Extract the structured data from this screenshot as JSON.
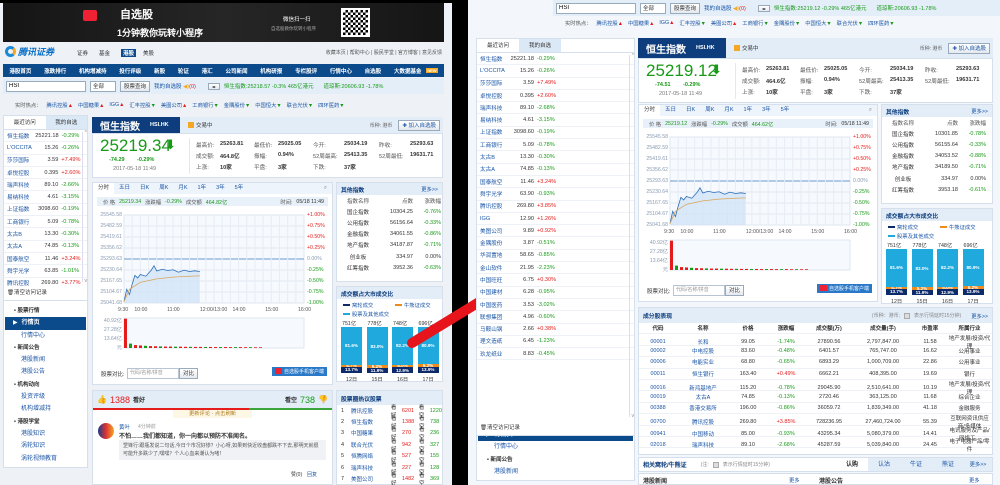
{
  "colors": {
    "up": "#e41c1c",
    "down": "#189a18",
    "brand": "#0b4a8b",
    "arrow": "#e8141b",
    "cyan": "#1fa9dc",
    "orange": "#f08a1c",
    "navy": "#0d2a6b"
  },
  "common": {
    "top_tabs": [
      "证券",
      "基金",
      "港股",
      "美股"
    ],
    "top_links": "收藏本页 | 帮助中心 | 股民学堂 | 官方博客 | 意见反馈",
    "nav": [
      "港股首页",
      "涨跌排行",
      "机构增减持",
      "投行评级",
      "新股",
      "轮证",
      "港汇",
      "公司新闻",
      "机构研报",
      "专栏股评",
      "行情中心",
      "自选股",
      "大数据基金"
    ],
    "nav_badge": "NEW",
    "banner": {
      "title": "自选股",
      "subtitle": "1分钟教你玩转小程序",
      "wechat": "微信扫一扫",
      "wechat_sub": "自选股教你玩转小程序"
    },
    "logo": "腾讯证券",
    "search": {
      "value": "HSI",
      "select": "全部",
      "button": "股票查询",
      "mywatch": "我的自选股",
      "mywatch_count": "(0)"
    },
    "hot": {
      "label": "实时热点：",
      "items": [
        [
          "腾讯控股",
          "up"
        ],
        [
          "中国糖果",
          "up"
        ],
        [
          "IGG",
          "up"
        ],
        [
          "汇丰控股",
          "down"
        ],
        [
          "美图公司",
          "up"
        ],
        [
          "工商银行",
          "down"
        ],
        [
          "金隅股份",
          "down"
        ],
        [
          "中国恒大",
          "down"
        ],
        [
          "联合光伏",
          "down"
        ],
        [
          "四环医药",
          "down"
        ]
      ]
    },
    "sidebar_tabs": [
      "最近访问",
      "我的自选"
    ],
    "clear_record": "清空访问记录",
    "header": {
      "title": "恒生指数",
      "code": "HSI.HK",
      "status": "交易中",
      "currency": "币种: 港币",
      "add": "加入自选股"
    },
    "stat_labels": [
      "最高价:",
      "最低价:",
      "今开:",
      "昨收:",
      "成交额:",
      "振幅:",
      "52周最高:",
      "52周最低:",
      "上涨:",
      "平盘:",
      "下跌:"
    ],
    "chart_tabs": [
      "分时",
      "五日",
      "日K",
      "周K",
      "月K",
      "1年",
      "3年",
      "5年"
    ],
    "info_labels": [
      "价 格",
      "涨跌幅",
      "成交额",
      "时间:"
    ],
    "y_labels": [
      "25545.58",
      "25482.59",
      "25419.61",
      "25356.62",
      "25293.63",
      "25230.64",
      "25167.65",
      "25104.67",
      "25041.68"
    ],
    "pct_labels": [
      "+1.00%",
      "+0.75%",
      "+0.50%",
      "+0.25%",
      "0.00%",
      "-0.25%",
      "-0.50%",
      "-0.75%",
      "-1.00%"
    ],
    "time_labels": [
      [
        "9:30",
        0
      ],
      [
        "10:00",
        30
      ],
      [
        "11:00",
        90
      ],
      [
        "12:00/13:00",
        150
      ],
      [
        "14:00",
        210
      ],
      [
        "15:00",
        270
      ],
      [
        "16:00",
        330
      ]
    ],
    "vol_labels": [
      "40.92亿",
      "27.28亿",
      "13.64亿",
      "元"
    ],
    "price_range": [
      25041.68,
      25545.58
    ],
    "intraday": [
      [
        0,
        25050
      ],
      [
        5,
        25120
      ],
      [
        10,
        25090
      ],
      [
        15,
        25150
      ],
      [
        20,
        25200
      ],
      [
        25,
        25185
      ],
      [
        30,
        25205
      ],
      [
        40,
        25195
      ],
      [
        50,
        25230
      ],
      [
        55,
        25255
      ],
      [
        60,
        25225
      ],
      [
        70,
        25235
      ],
      [
        80,
        25228
      ],
      [
        90,
        25232
      ],
      [
        100,
        25218
      ],
      [
        110,
        25230
      ],
      [
        120,
        25222
      ],
      [
        130,
        25226
      ],
      [
        139,
        25222
      ]
    ],
    "average": [
      [
        0,
        25050
      ],
      [
        10,
        25120
      ],
      [
        30,
        25160
      ],
      [
        60,
        25180
      ],
      [
        90,
        25190
      ],
      [
        120,
        25195
      ],
      [
        139,
        25197
      ]
    ],
    "volume": [
      40,
      6,
      4,
      3.5,
      3,
      2.6,
      2.4,
      2.2,
      2,
      2,
      1.8,
      1.8,
      1.6,
      1.6,
      1.5,
      1.5,
      1.4,
      1.4,
      1.3,
      1.3,
      1.3,
      1.2,
      1.2,
      1.2,
      1.1,
      1.1,
      1,
      1
    ],
    "compare": {
      "label": "股票对比:",
      "placeholder": "代码/名称/拼音",
      "button": "对比",
      "client": "自选股手机客户端"
    },
    "other_title": "其他指数",
    "more": "更多>>",
    "other_headers": [
      "指数名称",
      "点数",
      "涨跌幅"
    ],
    "ratio": {
      "title": "成交额占大市成交比",
      "legend": [
        "窝轮成交",
        "牛熊证成交",
        "股票及其他成交"
      ],
      "bars": [
        {
          "total": "751亿",
          "stock": 81.6,
          "cbbc": 4.7,
          "warrant": 13.7,
          "day": "12日"
        },
        {
          "total": "778亿",
          "stock": 83.0,
          "cbbc": 5.2,
          "warrant": 11.9,
          "day": "15日"
        },
        {
          "total": "748亿",
          "stock": 82.2,
          "cbbc": 5.0,
          "warrant": 12.9,
          "day": "16日"
        },
        {
          "total": "696亿",
          "stock": 80.9,
          "cbbc": 5.2,
          "warrant": 13.9,
          "day": "17日"
        }
      ]
    },
    "sidenav": [
      {
        "title": "股票行情",
        "items": [
          "行情页",
          "行情中心"
        ]
      },
      {
        "title": "新闻公告",
        "items": [
          "港股新闻",
          "港股公告"
        ]
      },
      {
        "title": "机构动向",
        "items": [
          "投资评级",
          "机构增减持"
        ]
      },
      {
        "title": "港股学堂",
        "items": [
          "港股知识",
          "涡轮知识",
          "涡轮视频教育"
        ]
      }
    ],
    "sidenav_active": "行情页"
  },
  "left": {
    "ticker": "恒生指数:25218.57 -0.3% 465亿港元",
    "ticker2": "道琼斯:20606.93 -1.78%",
    "watchlist": [
      [
        "恒生指数",
        "25221.18",
        "-0.29%"
      ],
      [
        "L'OCCITA",
        "15.26",
        "-0.26%"
      ],
      [
        "莎莎国际",
        "3.59",
        "+7.49%"
      ],
      [
        "卓悦控股",
        "0.395",
        "+2.60%"
      ],
      [
        "瑞声科技",
        "89.10",
        "-2.66%"
      ],
      [
        "易纳科技",
        "4.61",
        "-3.15%"
      ],
      [
        "上证指数",
        "3098.60",
        "-0.19%"
      ],
      [
        "工商银行",
        "5.09",
        "-0.78%"
      ],
      [
        "太古B",
        "13.30",
        "-0.30%"
      ],
      [
        "太古A",
        "74.85",
        "-0.13%"
      ],
      [
        "国泰航空",
        "11.46",
        "+3.24%"
      ],
      [
        "舜宇光学",
        "63.85",
        "-1.01%"
      ],
      [
        "腾讯控股",
        "269.80",
        "+3.77%"
      ]
    ],
    "quote": {
      "price": "25219.34",
      "change": "-74.29",
      "pct": "-0.29%",
      "time": "2017-05-18 11:49",
      "stats": [
        "25263.81",
        "25025.05",
        "25034.19",
        "25293.63",
        "464.8亿",
        "0.94%",
        "25413.35",
        "19631.71",
        "10家",
        "3家",
        "37家"
      ]
    },
    "info": [
      "25219.34",
      "-0.29%",
      "464.82亿",
      "05/18 11:49"
    ],
    "others": [
      [
        "国企指数",
        "10304.25",
        "-0.76%"
      ],
      [
        "公用指数",
        "56156.64",
        "-0.33%"
      ],
      [
        "金融指数",
        "34061.55",
        "-0.86%"
      ],
      [
        "地产指数",
        "34187.87",
        "-0.71%"
      ],
      [
        "创业板",
        "334.97",
        "0.00%"
      ],
      [
        "红筹指数",
        "3952.36",
        "-0.63%"
      ]
    ],
    "sentiment": {
      "bull": 1388,
      "bull_label": "看好",
      "bear": 738,
      "bear_label": "看空",
      "refresh": "更新评论 · 点击刷新"
    },
    "comment": {
      "user": "黄叶",
      "time": "4分钟前",
      "text": "不怕……我们都知道，你一向都以预防不准闻名。",
      "quote": "罡锋行:跟瓶发说二句话,今日个市况好惨？小心呀,如果到快近收盘都跌不下去,那明天就很可能升多跌少了,嘿嘿？个人心血来潮认为啫！",
      "like": "赞(0)",
      "reply": "回复"
    },
    "hot_stocks": {
      "title": "股票圈热议股票",
      "bull": "看好",
      "bear": "看空",
      "rows": [
        [
          "1",
          "腾讯控股",
          "6201",
          "1220"
        ],
        [
          "2",
          "恒生指数",
          "1388",
          "738"
        ],
        [
          "3",
          "中国糖果",
          "270",
          "236"
        ],
        [
          "4",
          "联合光伏",
          "942",
          "327"
        ],
        [
          "5",
          "恒腾网络",
          "527",
          "155"
        ],
        [
          "6",
          "瑞声科技",
          "227",
          "128"
        ],
        [
          "7",
          "美图公司",
          "1482",
          "369"
        ]
      ]
    }
  },
  "right": {
    "ticker": "恒生指数:25219.12 -0.29% 465亿港元",
    "ticker2": "道琼斯:20606.93 -1.78%",
    "watchlist": [
      [
        "恒生指数",
        "25221.18",
        "-0.29%"
      ],
      [
        "L'OCCITA",
        "15.26",
        "-0.26%"
      ],
      [
        "莎莎国际",
        "3.59",
        "+7.49%"
      ],
      [
        "卓悦控股",
        "0.395",
        "+2.60%"
      ],
      [
        "瑞声科技",
        "89.10",
        "-2.68%"
      ],
      [
        "易纳科技",
        "4.61",
        "-3.15%"
      ],
      [
        "上证指数",
        "3098.60",
        "-0.19%"
      ],
      [
        "工商银行",
        "5.09",
        "-0.78%"
      ],
      [
        "太古B",
        "13.30",
        "-0.30%"
      ],
      [
        "太古A",
        "74.85",
        "-0.13%"
      ],
      [
        "国泰航空",
        "11.46",
        "+3.24%"
      ],
      [
        "舜宇光学",
        "63.90",
        "-0.93%"
      ],
      [
        "腾讯控股",
        "269.80",
        "+3.85%"
      ],
      [
        "IGG",
        "12.90",
        "+1.26%"
      ],
      [
        "美图公司",
        "9.89",
        "+0.92%"
      ],
      [
        "金隅股份",
        "3.87",
        "-0.51%"
      ],
      [
        "华润置地",
        "58.65",
        "-0.85%"
      ],
      [
        "金山软件",
        "21.95",
        "-2.23%"
      ],
      [
        "中国旺旺",
        "6.75",
        "+0.30%"
      ],
      [
        "中国建材",
        "6.28",
        "-0.95%"
      ],
      [
        "中国医药",
        "3.53",
        "-3.02%"
      ],
      [
        "联想集团",
        "4.96",
        "-0.60%"
      ],
      [
        "马鞍山钢",
        "2.66",
        "+0.38%"
      ],
      [
        "理文造纸",
        "6.45",
        "-1.23%"
      ],
      [
        "玖龙纸业",
        "8.83",
        "-0.45%"
      ]
    ],
    "quote": {
      "price": "25219.12",
      "change": "-74.51",
      "pct": "-0.29%",
      "time": "2017-05-18 11:49",
      "stats": [
        "25263.81",
        "25025.05",
        "25034.19",
        "25293.63",
        "464.6亿",
        "0.94%",
        "25413.35",
        "19631.71",
        "10家",
        "3家",
        "37家"
      ]
    },
    "info": [
      "25219.12",
      "-0.29%",
      "464.62亿",
      "05/18 11:49"
    ],
    "others": [
      [
        "国企指数",
        "10301.85",
        "-0.78%"
      ],
      [
        "公用指数",
        "56155.64",
        "-0.33%"
      ],
      [
        "金融指数",
        "34053.52",
        "-0.88%"
      ],
      [
        "地产指数",
        "34189.50",
        "-0.71%"
      ],
      [
        "创业板",
        "334.97",
        "0.00%"
      ],
      [
        "红筹指数",
        "3953.18",
        "-0.61%"
      ]
    ],
    "constituents": {
      "title": "成分股表现",
      "note": "(币种：港币; ",
      "note2": "表示行情延时15分钟)",
      "more": "更多>>",
      "headers": [
        "代码",
        "名称",
        "价格",
        "涨跌幅",
        "成交额(万)",
        "成交量(手)",
        "市盈率",
        "所属行业"
      ],
      "rows": [
        [
          "00001",
          "长和",
          "99.05",
          "-1.74%",
          "27890.56",
          "2,797,847.00",
          "11.58",
          "地产发展/投资/代理"
        ],
        [
          "00002",
          "中电控股",
          "83.60",
          "-0.48%",
          "6401.57",
          "765,747.00",
          "16.62",
          "公用事业"
        ],
        [
          "00006",
          "电能实业",
          "68.80",
          "-0.65%",
          "6893.29",
          "1,000,709.00",
          "22.86",
          "公用事业"
        ],
        [
          "00011",
          "恒生银行",
          "163.40",
          "+0.49%",
          "6662.21",
          "408,395.00",
          "19.69",
          "银行"
        ],
        [
          "00016",
          "新鸿基地产",
          "115.20",
          "-0.78%",
          "29045.90",
          "2,510,641.00",
          "10.19",
          "地产发展/投资/代理"
        ],
        [
          "00019",
          "太古A",
          "74.85",
          "-0.13%",
          "2720.46",
          "363,125.00",
          "11.68",
          "综合企业"
        ],
        [
          "00388",
          "香港交易所",
          "196.00",
          "-0.86%",
          "36059.72",
          "1,839,349.00",
          "41.18",
          "金融服务"
        ],
        [
          "00700",
          "腾讯控股",
          "269.80",
          "+3.85%",
          "728236.95",
          "27,460,724.00",
          "55.39",
          "互联网资讯供应商/多媒体"
        ],
        [
          "00941",
          "中国移动",
          "85.00",
          "-0.93%",
          "43295.34",
          "5,080,379.00",
          "14.41",
          "电讯服务及产品/网络工..."
        ],
        [
          "02018",
          "瑞声科技",
          "89.10",
          "-2.68%",
          "45287.59",
          "5,039,840.00",
          "24.45",
          "电子电器产品/零件"
        ]
      ]
    },
    "warrants": {
      "title": "相关窝轮/牛熊证",
      "note": "(注:",
      "note2": "表示行情延时15分钟)",
      "tabs": [
        "认购",
        "认沽",
        "牛证",
        "熊证"
      ],
      "more": "更多>>"
    },
    "news": {
      "title": "港股新闻",
      "more": "更多",
      "title2": "港股公告",
      "more2": "更多"
    }
  }
}
